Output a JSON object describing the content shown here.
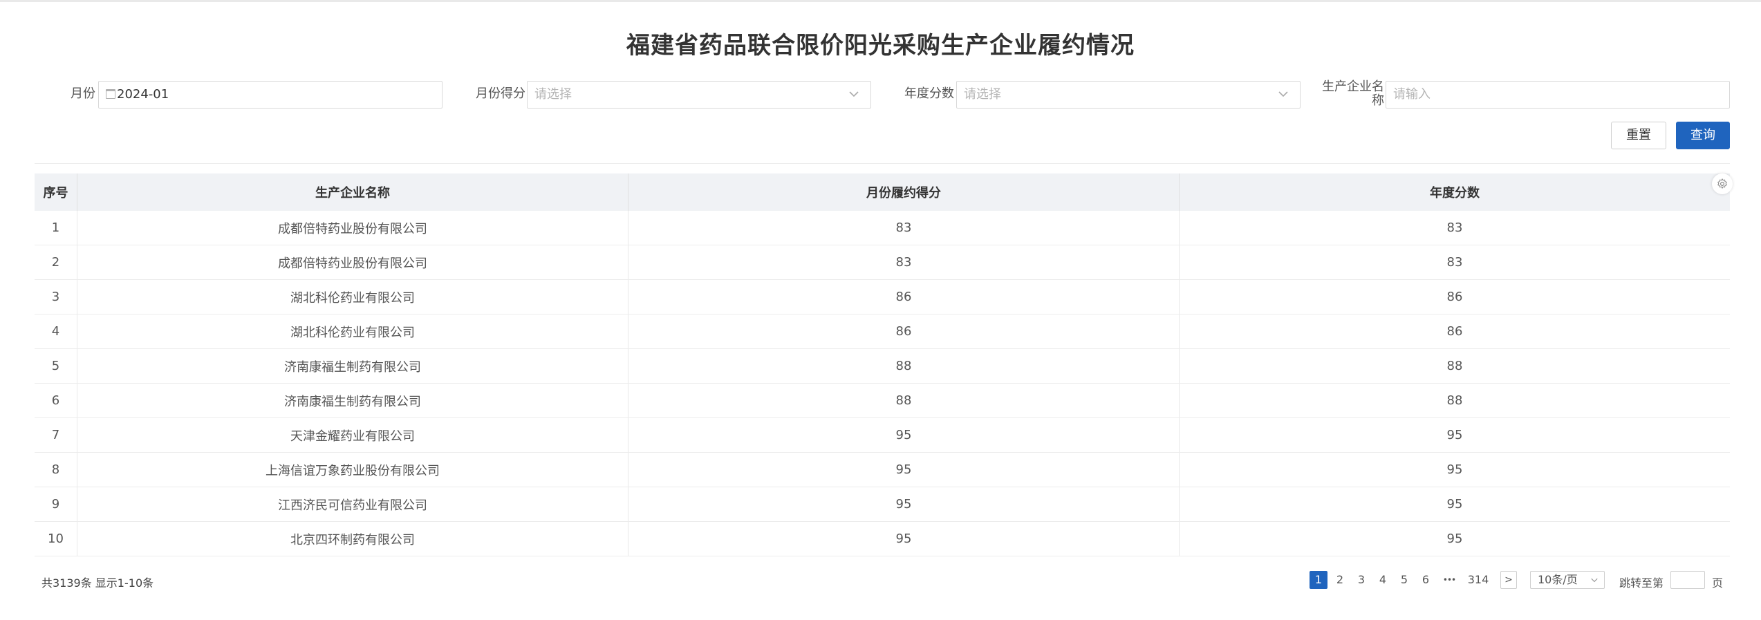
{
  "title": "福建省药品联合限价阳光采购生产企业履约情况",
  "filters": {
    "month": {
      "label": "月份",
      "value": "2024-01"
    },
    "month_score": {
      "label": "月份得分",
      "placeholder": "请选择"
    },
    "annual_score": {
      "label": "年度分数",
      "placeholder": "请选择"
    },
    "company_name": {
      "label_line1": "生产企业名",
      "label_line2": "称",
      "placeholder": "请输入"
    }
  },
  "buttons": {
    "reset": "重置",
    "query": "查询"
  },
  "table": {
    "headers": [
      "序号",
      "生产企业名称",
      "月份履约得分",
      "年度分数"
    ],
    "rows": [
      [
        "1",
        "成都倍特药业股份有限公司",
        "83",
        "83"
      ],
      [
        "2",
        "成都倍特药业股份有限公司",
        "83",
        "83"
      ],
      [
        "3",
        "湖北科伦药业有限公司",
        "86",
        "86"
      ],
      [
        "4",
        "湖北科伦药业有限公司",
        "86",
        "86"
      ],
      [
        "5",
        "济南康福生制药有限公司",
        "88",
        "88"
      ],
      [
        "6",
        "济南康福生制药有限公司",
        "88",
        "88"
      ],
      [
        "7",
        "天津金耀药业有限公司",
        "95",
        "95"
      ],
      [
        "8",
        "上海信谊万象药业股份有限公司",
        "95",
        "95"
      ],
      [
        "9",
        "江西济民可信药业有限公司",
        "95",
        "95"
      ],
      [
        "10",
        "北京四环制药有限公司",
        "95",
        "95"
      ]
    ]
  },
  "footer": {
    "summary": "共3139条 显示1-10条",
    "pages": [
      "1",
      "2",
      "3",
      "4",
      "5",
      "6"
    ],
    "ellipsis": "•••",
    "last_page": "314",
    "next": ">",
    "page_size": "10条/页",
    "jump_label": "跳转至第",
    "jump_suffix": "页"
  },
  "colors": {
    "primary": "#1f64be",
    "header_bg": "#f0f2f5"
  },
  "icons": [
    "calendar-icon",
    "chevron-down-icon",
    "gear-icon"
  ]
}
